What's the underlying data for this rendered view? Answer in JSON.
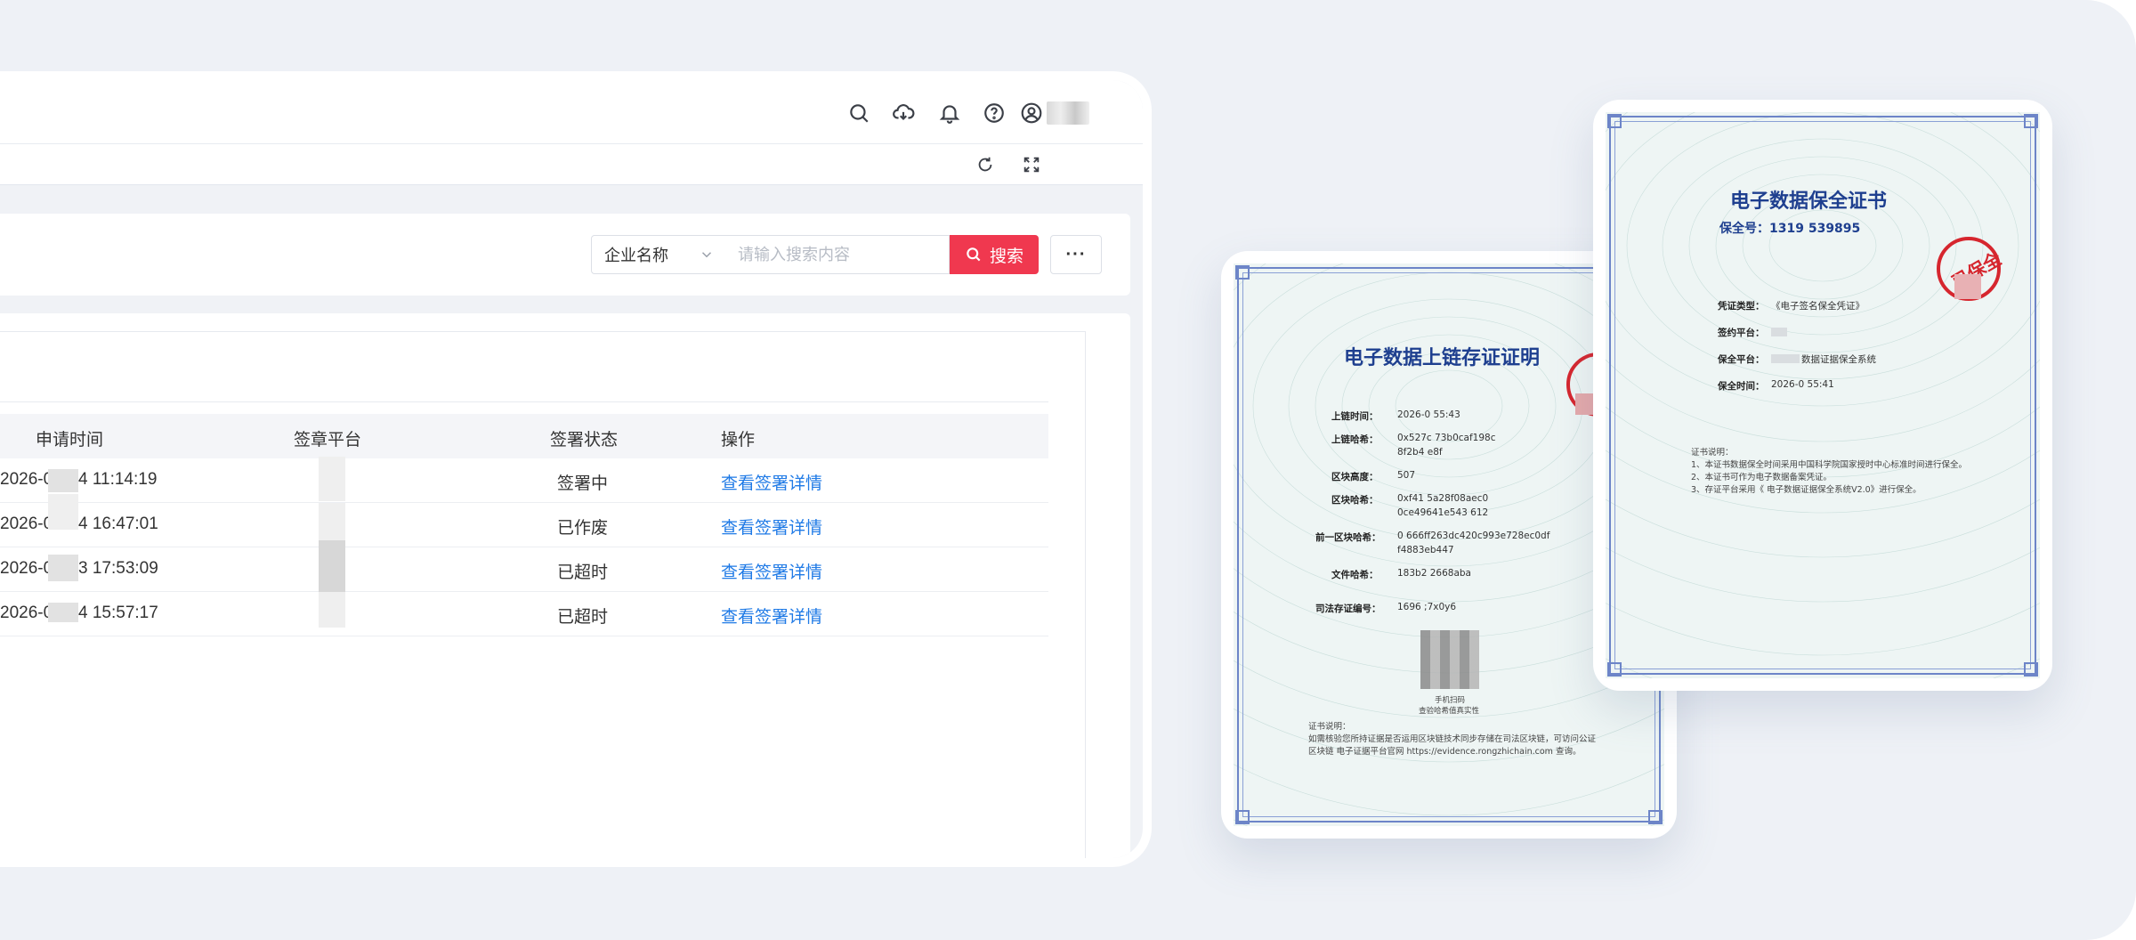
{
  "header": {
    "icons": [
      "search-icon",
      "cloud-download-icon",
      "bell-icon",
      "help-icon",
      "user-icon"
    ]
  },
  "tabbar": {
    "icons": [
      "refresh-icon",
      "fullscreen-icon"
    ]
  },
  "search": {
    "select_value": "企业名称",
    "placeholder": "请输入搜索内容",
    "button_label": "搜索",
    "more_label": "···"
  },
  "table": {
    "columns": [
      "申请时间",
      "签章平台",
      "签署状态",
      "操作"
    ],
    "rows": [
      {
        "time_prefix": "2026-0",
        "time_suffix": "4 11:14:19",
        "status": "签署中",
        "action": "查看签署详情"
      },
      {
        "time_prefix": "2026-0",
        "time_suffix": "4 16:47:01",
        "status": "已作废",
        "action": "查看签署详情"
      },
      {
        "time_prefix": "2026-0",
        "time_suffix": "3 17:53:09",
        "status": "已超时",
        "action": "查看签署详情"
      },
      {
        "time_prefix": "2026-0",
        "time_suffix": "4 15:57:17",
        "status": "已超时",
        "action": "查看签署详情"
      }
    ]
  },
  "cert_chain": {
    "title": "电子数据上链存证证明",
    "lines": [
      {
        "label": "上链时间：",
        "value": "2026-0          55:43"
      },
      {
        "label": "上链哈希：",
        "value": "0x527c                               73b0caf198c"
      },
      {
        "label": "",
        "value": "8f2b4                                  e8f"
      },
      {
        "label": "区块高度：",
        "value": "507"
      },
      {
        "label": "区块哈希：",
        "value": "0xf41                               5a28f08aec0"
      },
      {
        "label": "",
        "value": "0ce49641e543                        612"
      },
      {
        "label": "前一区块哈希：",
        "value": "0           666ff263dc420c993e728ec0df"
      },
      {
        "label": "",
        "value": "f4883eb447"
      },
      {
        "label": "文件哈希：",
        "value": "183b2                        2668aba"
      },
      {
        "label": "司法存证编号：",
        "value": "1696                            ;7x0y6"
      }
    ],
    "qr_caption_1": "手机扫码",
    "qr_caption_2": "查验哈希值真实性",
    "note_title": "证书说明：",
    "note_1": "如需核验您所持证据是否运用区块链技术同步存储在司法区块链，可访问公证",
    "note_2": "区块链 电子证据平台官网 https://evidence.rongzhichain.com 查询。"
  },
  "cert_preserve": {
    "title": "电子数据保全证书",
    "number": "保全号：1319                    539895",
    "stamp_text": "已保全",
    "lines": [
      {
        "label": "凭证类型：",
        "value": "《电子签名保全凭证》"
      },
      {
        "label": "签约平台：",
        "value": ""
      },
      {
        "label": "保全平台：",
        "value": "数据证据保全系统"
      },
      {
        "label": "保全时间：",
        "value": "2026-0          55:41"
      }
    ],
    "note_title": "证书说明：",
    "note_1": "1、本证书数据保全时间采用中国科学院国家授时中心标准时间进行保全。",
    "note_2": "2、本证书可作为电子数据备案凭证。",
    "note_3": "3、存证平台采用《      电子数据证据保全系统V2.0》进行保全。"
  },
  "colors": {
    "accent_red": "#f0384f",
    "link_blue": "#1f7ae6",
    "cert_title_blue": "#1e3f8f",
    "stamp_red": "#d6262e"
  }
}
